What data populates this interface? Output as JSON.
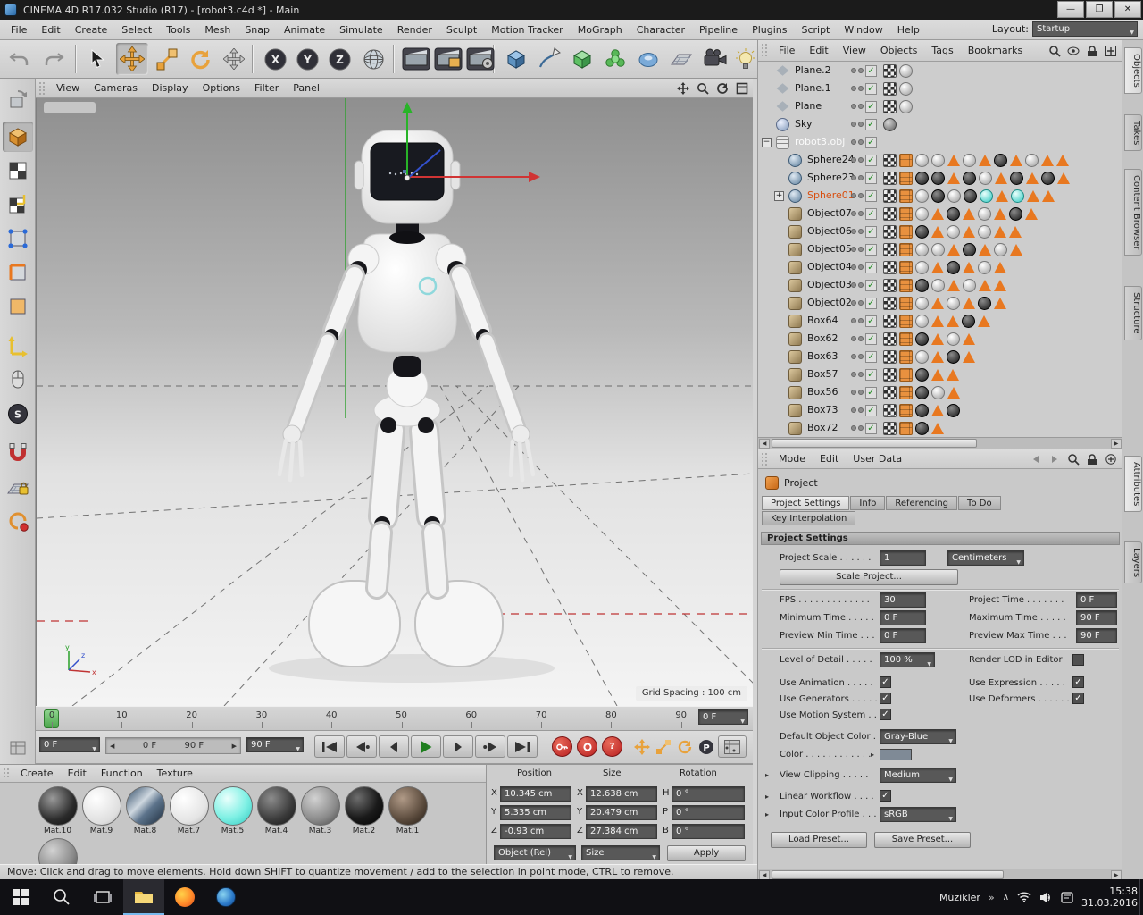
{
  "titlebar": {
    "title": "CINEMA 4D R17.032 Studio (R17) - [robot3.c4d *] - Main"
  },
  "menubar": {
    "items": [
      "File",
      "Edit",
      "Create",
      "Select",
      "Tools",
      "Mesh",
      "Snap",
      "Animate",
      "Simulate",
      "Render",
      "Sculpt",
      "Motion Tracker",
      "MoGraph",
      "Character",
      "Pipeline",
      "Plugins",
      "Script",
      "Window",
      "Help"
    ],
    "layout_label": "Layout:",
    "layout_value": "Startup"
  },
  "toolbar": {
    "buttons": [
      "undo",
      "redo",
      "live-selection",
      "move",
      "scale",
      "rotate",
      "last-tool",
      "lock-x",
      "lock-y",
      "lock-z",
      "coordinate-system",
      "render-view",
      "render-picture-viewer",
      "render-settings",
      "add-cube",
      "add-spline",
      "add-subdivision",
      "add-generator",
      "add-volume",
      "add-floor",
      "add-camera",
      "add-light"
    ],
    "axis_letters": [
      "X",
      "Y",
      "Z"
    ]
  },
  "side_toolbar": {
    "buttons": [
      "make-editable",
      "model-mode",
      "texture-mode",
      "texture-axis-mode",
      "points-mode",
      "edges-mode",
      "polygons-mode",
      "axis-mode",
      "snap-mode",
      "viewport-solo",
      "magnet",
      "lock-workplane",
      "quantize"
    ]
  },
  "viewport": {
    "menu": [
      "View",
      "Cameras",
      "Display",
      "Options",
      "Filter",
      "Panel"
    ],
    "grid_spacing": "Grid Spacing : 100 cm",
    "axis_labels": {
      "x": "x",
      "y": "y",
      "z": "z"
    }
  },
  "object_manager": {
    "menu": [
      "File",
      "Edit",
      "View",
      "Objects",
      "Tags",
      "Bookmarks"
    ],
    "side_tabs": [
      {
        "label": "Objects",
        "active": true
      },
      {
        "label": "Takes",
        "active": false
      },
      {
        "label": "Content Browser",
        "active": false
      },
      {
        "label": "Structure",
        "active": false
      }
    ],
    "objects": [
      {
        "name": "Plane.2",
        "indent": 0,
        "icon": "plane",
        "tags": [
          "checker",
          "sphere-white"
        ]
      },
      {
        "name": "Plane.1",
        "indent": 0,
        "icon": "plane",
        "tags": [
          "checker",
          "sphere-white"
        ]
      },
      {
        "name": "Plane",
        "indent": 0,
        "icon": "plane",
        "tags": [
          "checker",
          "sphere-white"
        ]
      },
      {
        "name": "Sky",
        "indent": 0,
        "icon": "sky",
        "tags": [
          "sphere-gray"
        ]
      },
      {
        "name": "robot3.obj",
        "indent": 0,
        "icon": "file",
        "expander": "minus",
        "state": "active",
        "tags": []
      },
      {
        "name": "Sphere24",
        "indent": 1,
        "icon": "sphere",
        "tags": [
          "checker",
          "uv",
          "sphere-white",
          "sphere-white",
          "triangle",
          "sphere-white",
          "triangle",
          "sphere-dark",
          "triangle",
          "sphere-white",
          "triangle",
          "triangle"
        ]
      },
      {
        "name": "Sphere23",
        "indent": 1,
        "icon": "sphere",
        "tags": [
          "checker",
          "uv",
          "sphere-dark",
          "sphere-dark",
          "triangle",
          "sphere-dark",
          "sphere-white",
          "triangle",
          "sphere-dark",
          "triangle",
          "sphere-dark",
          "triangle"
        ]
      },
      {
        "name": "Sphere01",
        "indent": 1,
        "icon": "sphere",
        "expander": "plus",
        "state": "selected",
        "tags": [
          "checker",
          "uv",
          "sphere-white",
          "sphere-dark",
          "sphere-white",
          "sphere-dark",
          "sphere-cyan",
          "triangle",
          "sphere-cyan",
          "triangle",
          "triangle"
        ]
      },
      {
        "name": "Object07",
        "indent": 1,
        "icon": "polygon",
        "tags": [
          "checker",
          "uv",
          "sphere-white",
          "triangle",
          "sphere-dark",
          "triangle",
          "sphere-white",
          "triangle",
          "sphere-dark",
          "triangle"
        ]
      },
      {
        "name": "Object06",
        "indent": 1,
        "icon": "polygon",
        "tags": [
          "checker",
          "uv",
          "sphere-dark",
          "triangle",
          "sphere-white",
          "triangle",
          "sphere-white",
          "triangle",
          "triangle"
        ]
      },
      {
        "name": "Object05",
        "indent": 1,
        "icon": "polygon",
        "tags": [
          "checker",
          "uv",
          "sphere-white",
          "sphere-white",
          "triangle",
          "sphere-dark",
          "triangle",
          "sphere-white",
          "triangle"
        ]
      },
      {
        "name": "Object04",
        "indent": 1,
        "icon": "polygon",
        "tags": [
          "checker",
          "uv",
          "sphere-white",
          "triangle",
          "sphere-dark",
          "triangle",
          "sphere-white",
          "triangle"
        ]
      },
      {
        "name": "Object03",
        "indent": 1,
        "icon": "polygon",
        "tags": [
          "checker",
          "uv",
          "sphere-dark",
          "sphere-white",
          "triangle",
          "sphere-white",
          "triangle",
          "triangle"
        ]
      },
      {
        "name": "Object02",
        "indent": 1,
        "icon": "polygon",
        "tags": [
          "checker",
          "uv",
          "sphere-white",
          "triangle",
          "sphere-white",
          "triangle",
          "sphere-dark",
          "triangle"
        ]
      },
      {
        "name": "Box64",
        "indent": 1,
        "icon": "polygon",
        "tags": [
          "checker",
          "uv",
          "sphere-white",
          "triangle",
          "triangle",
          "sphere-dark",
          "triangle"
        ]
      },
      {
        "name": "Box62",
        "indent": 1,
        "icon": "polygon",
        "tags": [
          "checker",
          "uv",
          "sphere-dark",
          "triangle",
          "sphere-white",
          "triangle"
        ]
      },
      {
        "name": "Box63",
        "indent": 1,
        "icon": "polygon",
        "tags": [
          "checker",
          "uv",
          "sphere-white",
          "triangle",
          "sphere-dark",
          "triangle"
        ]
      },
      {
        "name": "Box57",
        "indent": 1,
        "icon": "polygon",
        "tags": [
          "checker",
          "uv",
          "sphere-dark",
          "triangle",
          "triangle"
        ]
      },
      {
        "name": "Box56",
        "indent": 1,
        "icon": "polygon",
        "tags": [
          "checker",
          "uv",
          "sphere-dark",
          "sphere-white",
          "triangle"
        ]
      },
      {
        "name": "Box73",
        "indent": 1,
        "icon": "polygon",
        "tags": [
          "checker",
          "uv",
          "sphere-dark",
          "triangle",
          "sphere-dark"
        ]
      },
      {
        "name": "Box72",
        "indent": 1,
        "icon": "polygon",
        "tags": [
          "checker",
          "uv",
          "sphere-dark",
          "triangle"
        ]
      }
    ]
  },
  "attributes": {
    "menu": [
      "Mode",
      "Edit",
      "User Data"
    ],
    "side_tabs": [
      {
        "label": "Attributes",
        "active": true
      },
      {
        "label": "Layers",
        "active": false
      }
    ],
    "object_name": "Project",
    "tabs": [
      "Project Settings",
      "Info",
      "Referencing",
      "To Do"
    ],
    "tab_key_interp": "Key Interpolation",
    "section": "Project Settings",
    "project_scale_label": "Project Scale . . . . . .",
    "project_scale_value": "1",
    "project_scale_unit": "Centimeters",
    "scale_project_button": "Scale Project...",
    "rows": [
      {
        "label": "FPS . . . . . . . . . . . . .",
        "value": "30",
        "label2": "Project Time . . . . . . .",
        "value2": "0 F"
      },
      {
        "label": "Minimum Time . . . . .",
        "value": "0 F",
        "label2": "Maximum Time . . . . .",
        "value2": "90 F"
      },
      {
        "label": "Preview Min Time . . .",
        "value": "0 F",
        "label2": "Preview Max Time . . .",
        "value2": "90 F"
      }
    ],
    "lod_label": "Level of Detail . . . . .",
    "lod_value": "100 %",
    "render_lod_label": "Render LOD in Editor",
    "render_lod_checked": false,
    "checks": [
      {
        "label": "Use Animation . . . . .",
        "checked": true,
        "label2": "Use Expression . . . . .",
        "checked2": true
      },
      {
        "label": "Use Generators . . . . .",
        "checked": true,
        "label2": "Use Deformers . . . . . .",
        "checked2": true
      },
      {
        "label": "Use Motion System . .",
        "checked": true
      }
    ],
    "default_color_label": "Default Object Color . .",
    "default_color_value": "Gray-Blue",
    "color_label": "Color . . . . . . . . . . . .",
    "color_swatch": "#7f8a96",
    "view_clipping_label": "View Clipping . . . . .",
    "view_clipping_value": "Medium",
    "linear_workflow_label": "Linear Workflow . . . .",
    "linear_workflow_checked": true,
    "input_profile_label": "Input Color Profile . . .",
    "input_profile_value": "sRGB",
    "load_preset": "Load Preset...",
    "save_preset": "Save Preset..."
  },
  "timeline": {
    "ticks": [
      "0",
      "10",
      "20",
      "30",
      "40",
      "50",
      "60",
      "70",
      "80",
      "90"
    ],
    "frame": "0 F"
  },
  "transport": {
    "current": "0 F",
    "range_start": "0 F",
    "range_end": "90 F",
    "end": "90 F",
    "buttons": [
      "goto-start",
      "prev-key",
      "prev-frame",
      "play",
      "next-frame",
      "next-key",
      "goto-end"
    ],
    "record_buttons": [
      "record-active",
      "autokey",
      "record-options"
    ],
    "toggles": [
      "key-position",
      "key-scale",
      "key-rotation",
      "key-parameter",
      "key-pla"
    ]
  },
  "materials": {
    "menu": [
      "Create",
      "Edit",
      "Function",
      "Texture"
    ],
    "items": [
      {
        "name": "Mat.10",
        "style": "dark"
      },
      {
        "name": "Mat.9",
        "style": "white"
      },
      {
        "name": "Mat.8",
        "style": "photo"
      },
      {
        "name": "Mat.7",
        "style": "light"
      },
      {
        "name": "Mat.5",
        "style": "cyan"
      },
      {
        "name": "Mat.4",
        "style": "dark2"
      },
      {
        "name": "Mat.3",
        "style": "gray"
      },
      {
        "name": "Mat.2",
        "style": "black"
      },
      {
        "name": "Mat.1",
        "style": "brown"
      }
    ]
  },
  "coordinates": {
    "headers": [
      "Position",
      "Size",
      "Rotation"
    ],
    "axis1": [
      "X",
      "Y",
      "Z"
    ],
    "axis3": [
      "H",
      "P",
      "B"
    ],
    "position": {
      "x": "10.345 cm",
      "y": "5.335 cm",
      "z": "-0.93 cm"
    },
    "size": {
      "x": "12.638 cm",
      "y": "20.479 cm",
      "z": "27.384 cm"
    },
    "rotation": {
      "h": "0 °",
      "p": "0 °",
      "b": "0 °"
    },
    "mode_object": "Object (Rel)",
    "mode_size": "Size",
    "apply": "Apply"
  },
  "statusbar": {
    "text": "Move: Click and drag to move elements. Hold down SHIFT to quantize movement / add to the selection in point mode, CTRL to remove."
  },
  "taskbar": {
    "tray_text": "Müzikler",
    "tray_more": "»",
    "tray_chevron": "∧",
    "time": "15:38",
    "date": "31.03.2016"
  },
  "icons": {
    "search-icon": "magnifier circle+handle svg",
    "lock-icon": "padlock svg",
    "plus-icon": "plus box",
    "eye-icon": "eye svg",
    "checker-tag-icon": "checkerboard swatch",
    "uv-tag-icon": "orange grid swatch",
    "phong-tag-icon": "orange triangle",
    "material-tag-icon": "shaded sphere",
    "move-icon": "orange 4-way arrows",
    "scale-icon": "orange squares",
    "rotate-icon": "orange circular arrow",
    "play-icon": "green triangle",
    "record-icon": "red circle",
    "windows-logo-icon": "2x2 white squares",
    "folder-icon": "yellow folder",
    "firefox-icon": "orange circle",
    "wifi-icon": "signal arcs",
    "speaker-icon": "speaker cone"
  }
}
